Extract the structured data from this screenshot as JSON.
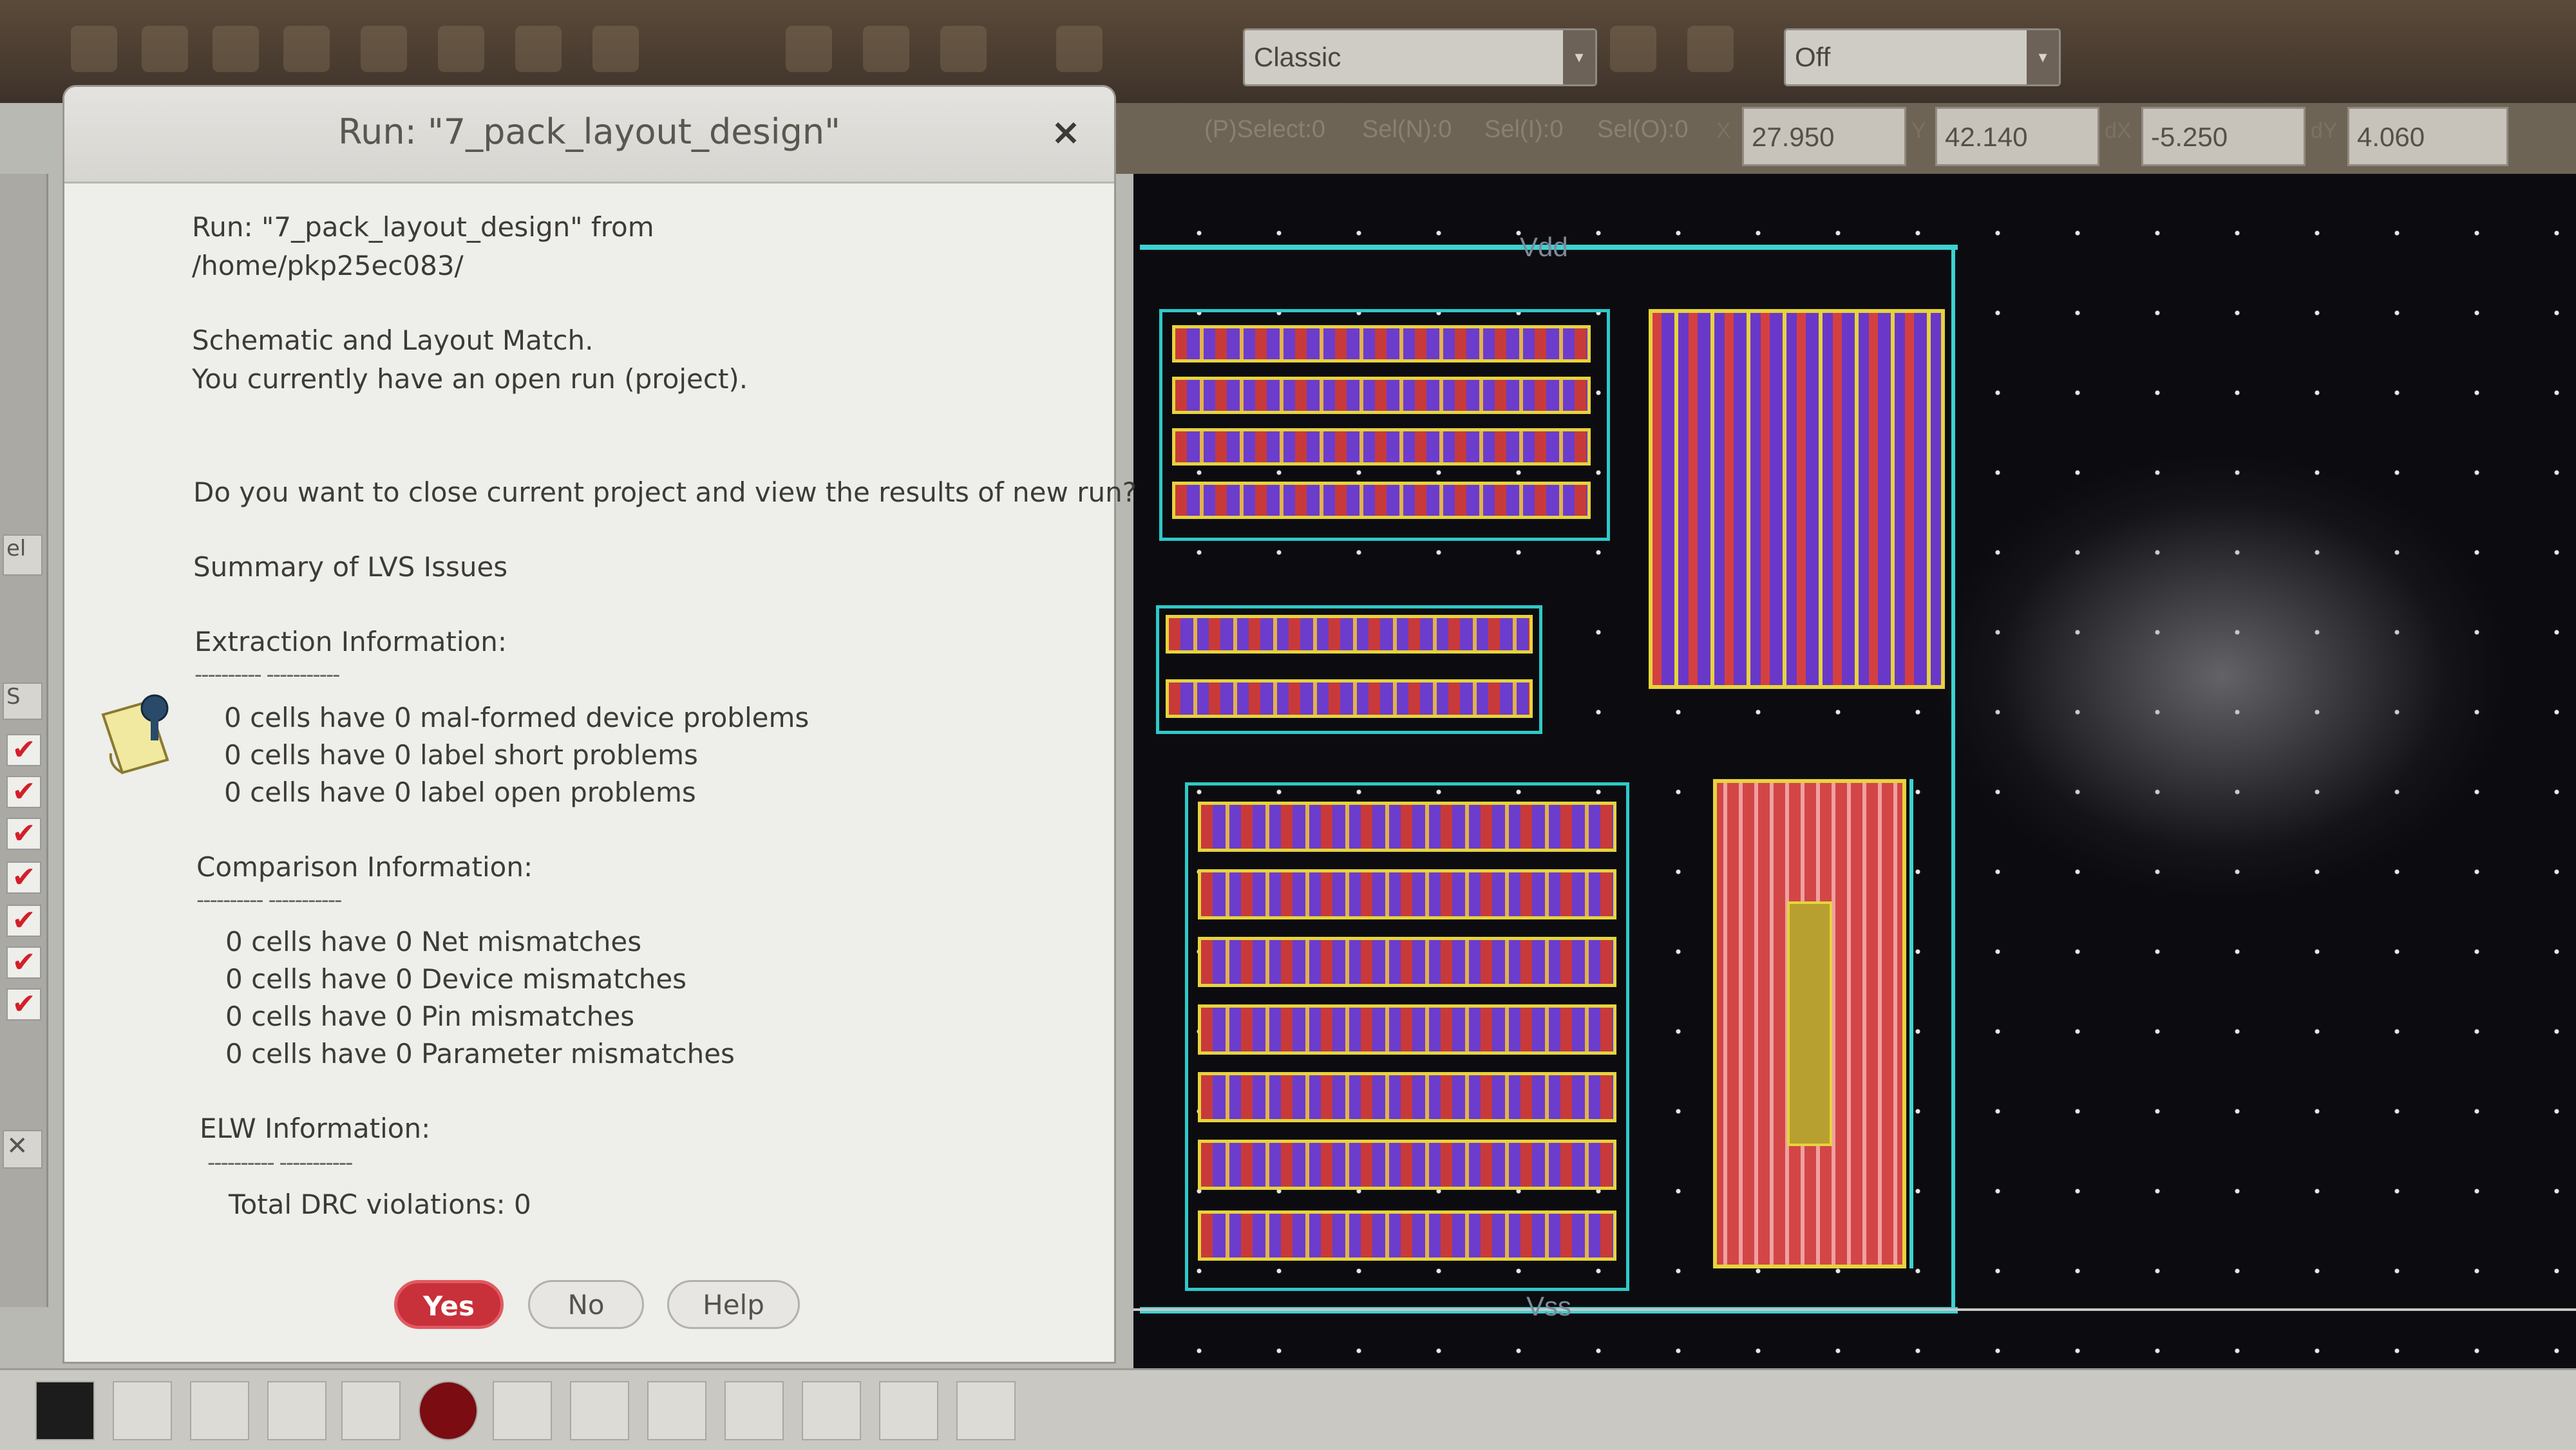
{
  "toolbar": {
    "style_select": "Classic",
    "mode_select": "Off"
  },
  "status": {
    "p_select": "(P)Select:0",
    "sel_n": "Sel(N):0",
    "sel_i": "Sel(I):0",
    "sel_o": "Sel(O):0",
    "x_label": "X",
    "x_value": "27.950",
    "y_label": "Y",
    "y_value": "42.140",
    "dx_label": "dX",
    "dx_value": "-5.250",
    "dy_label": "dY",
    "dy_value": "4.060"
  },
  "canvas": {
    "vdd_label": "Vdd",
    "vss_label": "Vss"
  },
  "dialog": {
    "title": "Run: \"7_pack_layout_design\"",
    "close_glyph": "×",
    "run_line1": "Run: \"7_pack_layout_design\"  from",
    "run_line2": "/home/pkp25ec083/",
    "match_line": "Schematic and Layout Match.",
    "open_run_line": "You currently have an open run (project).",
    "question": "Do you want to close current project and view the results of new run?",
    "summary_heading": "Summary of LVS Issues",
    "extraction_heading": "Extraction Information:",
    "extraction_dash": "---------- -----------",
    "extraction_items": [
      "0 cells have 0 mal-formed device problems",
      "0 cells have 0 label short problems",
      "0 cells have 0 label open problems"
    ],
    "comparison_heading": "Comparison Information:",
    "comparison_dash": "---------- -----------",
    "comparison_items": [
      "0 cells have 0 Net mismatches",
      "0 cells have 0 Device mismatches",
      "0 cells have 0 Pin mismatches",
      "0 cells have 0 Parameter mismatches"
    ],
    "elw_heading": "ELW Information:",
    "elw_dash": "---------- -----------",
    "drc_line": "Total DRC violations: 0",
    "buttons": {
      "yes": "Yes",
      "no": "No",
      "help": "Help"
    }
  },
  "left_dock": {
    "label_el": "el",
    "label_s": "S",
    "check_glyph": "✔"
  },
  "colors": {
    "yes_button": "#c8303a",
    "canvas_bg": "#0c0c10",
    "rail": "#3dd2d2",
    "metal_red": "#d44040",
    "poly_purple": "#6a38c8",
    "outline_yellow": "#e6d43c"
  }
}
